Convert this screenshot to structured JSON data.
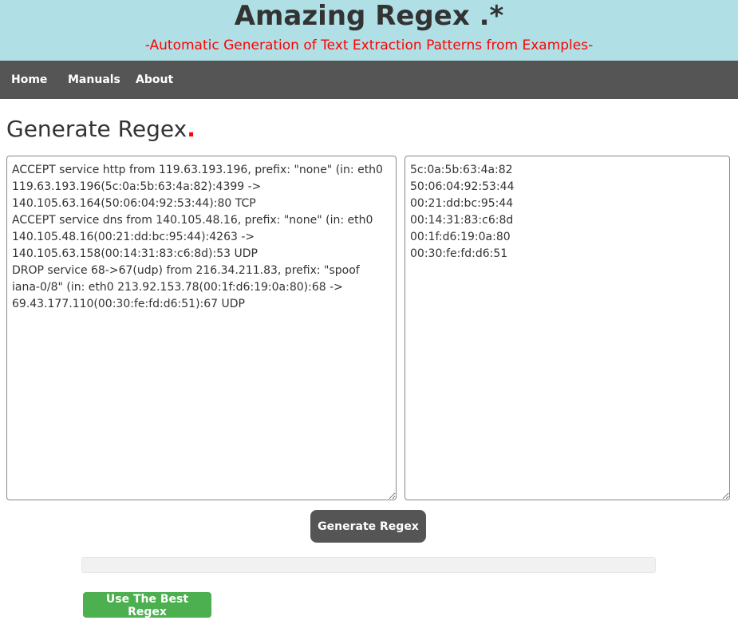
{
  "header": {
    "title": "Amazing Regex .*",
    "subtitle": "-Automatic Generation of Text Extraction Patterns from Examples-"
  },
  "nav": {
    "items": [
      {
        "label": "Home"
      },
      {
        "label": "Manuals"
      },
      {
        "label": "About"
      }
    ]
  },
  "main": {
    "title": "Generate Regex",
    "title_dot": "."
  },
  "source_input": {
    "value": "ACCEPT service http from 119.63.193.196, prefix: \"none\" (in: eth0 119.63.193.196(5c:0a:5b:63:4a:82):4399 -> 140.105.63.164(50:06:04:92:53:44):80 TCP\nACCEPT service dns from 140.105.48.16, prefix: \"none\" (in: eth0 140.105.48.16(00:21:dd:bc:95:44):4263 -> 140.105.63.158(00:14:31:83:c6:8d):53 UDP\nDROP service 68->67(udp) from 216.34.211.83, prefix: \"spoof iana-0/8\" (in: eth0 213.92.153.78(00:1f:d6:19:0a:80):68 -> 69.43.177.110(00:30:fe:fd:d6:51):67 UDP"
  },
  "target_input": {
    "value": "5c:0a:5b:63:4a:82\n50:06:04:92:53:44\n00:21:dd:bc:95:44\n00:14:31:83:c6:8d\n00:1f:d6:19:0a:80\n00:30:fe:fd:d6:51"
  },
  "actions": {
    "generate_label": "Generate Regex",
    "best_label": "Use The Best Regex"
  },
  "progress": {
    "value": 0
  },
  "colors": {
    "header_bg": "#b0e0e6",
    "subtitle": "#ff0000",
    "navbar_bg": "#555555",
    "best_button_bg": "#4caf50"
  }
}
